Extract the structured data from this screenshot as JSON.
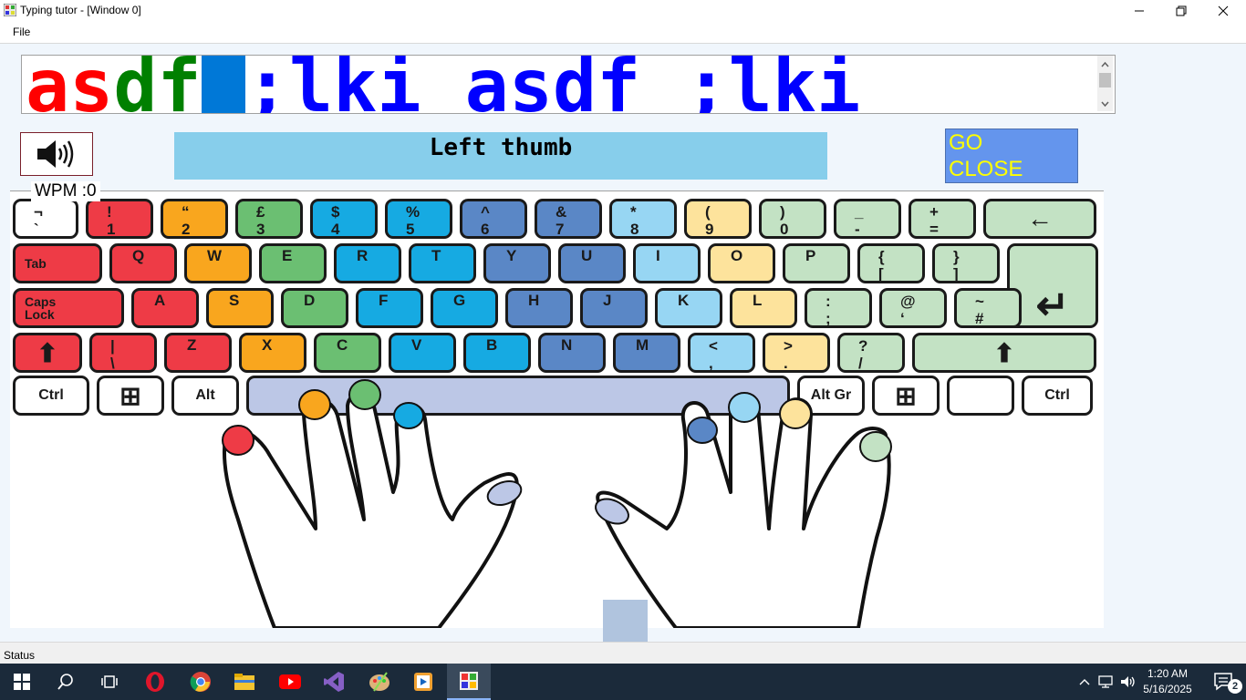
{
  "window": {
    "title": "Typing tutor - [Window 0]"
  },
  "menu": {
    "file": "File"
  },
  "typing": {
    "segments": [
      {
        "text": "as",
        "color": "#ff0000"
      },
      {
        "text": "df",
        "color": "#008000"
      },
      {
        "text": " ",
        "color": "#0000ff",
        "cursor": true
      },
      {
        "text": ";lki asdf ;lki",
        "color": "#0000ff"
      }
    ]
  },
  "wpm": "WPM :0",
  "finger_label": "Left thumb",
  "go_close": {
    "go": "GO",
    "close": "CLOSE"
  },
  "status": "Status",
  "colors": {
    "red": "#ee3b46",
    "orange": "#f9a61e",
    "green": "#6bbf72",
    "blue": "#16aae2",
    "dblue": "#5a87c6",
    "lblue": "#97d6f3",
    "yellow": "#fde39c",
    "lgreen": "#c3e2c4",
    "white": "#ffffff",
    "space": "#bcc7e6",
    "cursor": "#0078d7"
  },
  "keyboard": {
    "rows": [
      [
        [
          "¬",
          "`",
          "white"
        ],
        [
          "!",
          "1",
          "red"
        ],
        [
          "“",
          "2",
          "orange"
        ],
        [
          "£",
          "3",
          "green"
        ],
        [
          "$",
          "4",
          "blue"
        ],
        [
          "%",
          "5",
          "blue"
        ],
        [
          "^",
          "6",
          "dblue"
        ],
        [
          "&",
          "7",
          "dblue"
        ],
        [
          "*",
          "8",
          "lblue"
        ],
        [
          "(",
          "9",
          "yellow"
        ],
        [
          ")",
          "0",
          "lgreen"
        ],
        [
          "_",
          "-",
          "lgreen"
        ],
        [
          "+",
          "=",
          "lgreen"
        ],
        [
          "←",
          "",
          "lgreen"
        ]
      ],
      [
        [
          "Tab",
          "",
          "red"
        ],
        [
          "Q",
          "",
          "red"
        ],
        [
          "W",
          "",
          "orange"
        ],
        [
          "E",
          "",
          "green"
        ],
        [
          "R",
          "",
          "blue"
        ],
        [
          "T",
          "",
          "blue"
        ],
        [
          "Y",
          "",
          "dblue"
        ],
        [
          "U",
          "",
          "dblue"
        ],
        [
          "I",
          "",
          "lblue"
        ],
        [
          "O",
          "",
          "yellow"
        ],
        [
          "P",
          "",
          "lgreen"
        ],
        [
          "{",
          "[",
          "lgreen"
        ],
        [
          "}",
          "]",
          "lgreen"
        ],
        [
          "↵",
          "",
          "lgreen"
        ]
      ],
      [
        [
          "Caps\nLock",
          "",
          "red"
        ],
        [
          "A",
          "",
          "red"
        ],
        [
          "S",
          "",
          "orange"
        ],
        [
          "D",
          "",
          "green"
        ],
        [
          "F",
          "",
          "blue"
        ],
        [
          "G",
          "",
          "blue"
        ],
        [
          "H",
          "",
          "dblue"
        ],
        [
          "J",
          "",
          "dblue"
        ],
        [
          "K",
          "",
          "lblue"
        ],
        [
          "L",
          "",
          "yellow"
        ],
        [
          ":",
          ";",
          "lgreen"
        ],
        [
          "@",
          "‘",
          "lgreen"
        ],
        [
          "~",
          "#",
          "lgreen"
        ]
      ],
      [
        [
          "⬆",
          "",
          "red"
        ],
        [
          "|",
          "\\",
          "red"
        ],
        [
          "Z",
          "",
          "red"
        ],
        [
          "X",
          "",
          "orange"
        ],
        [
          "C",
          "",
          "green"
        ],
        [
          "V",
          "",
          "blue"
        ],
        [
          "B",
          "",
          "blue"
        ],
        [
          "N",
          "",
          "dblue"
        ],
        [
          "M",
          "",
          "dblue"
        ],
        [
          "<",
          ",",
          "lblue"
        ],
        [
          ">",
          ".",
          "yellow"
        ],
        [
          "?",
          "/",
          "lgreen"
        ],
        [
          "⬆",
          "",
          "lgreen"
        ]
      ],
      [
        [
          "Ctrl",
          "",
          "white"
        ],
        [
          "⊞",
          "",
          "white"
        ],
        [
          "Alt",
          "",
          "white"
        ],
        [
          "",
          "",
          "space"
        ],
        [
          "Alt Gr",
          "",
          "white"
        ],
        [
          "⊞",
          "",
          "white"
        ],
        [
          "",
          "",
          "white"
        ],
        [
          "Ctrl",
          "",
          "white"
        ]
      ]
    ]
  },
  "taskbar": {
    "time": "1:20 AM",
    "date": "5/16/2025",
    "notifications": "2"
  }
}
